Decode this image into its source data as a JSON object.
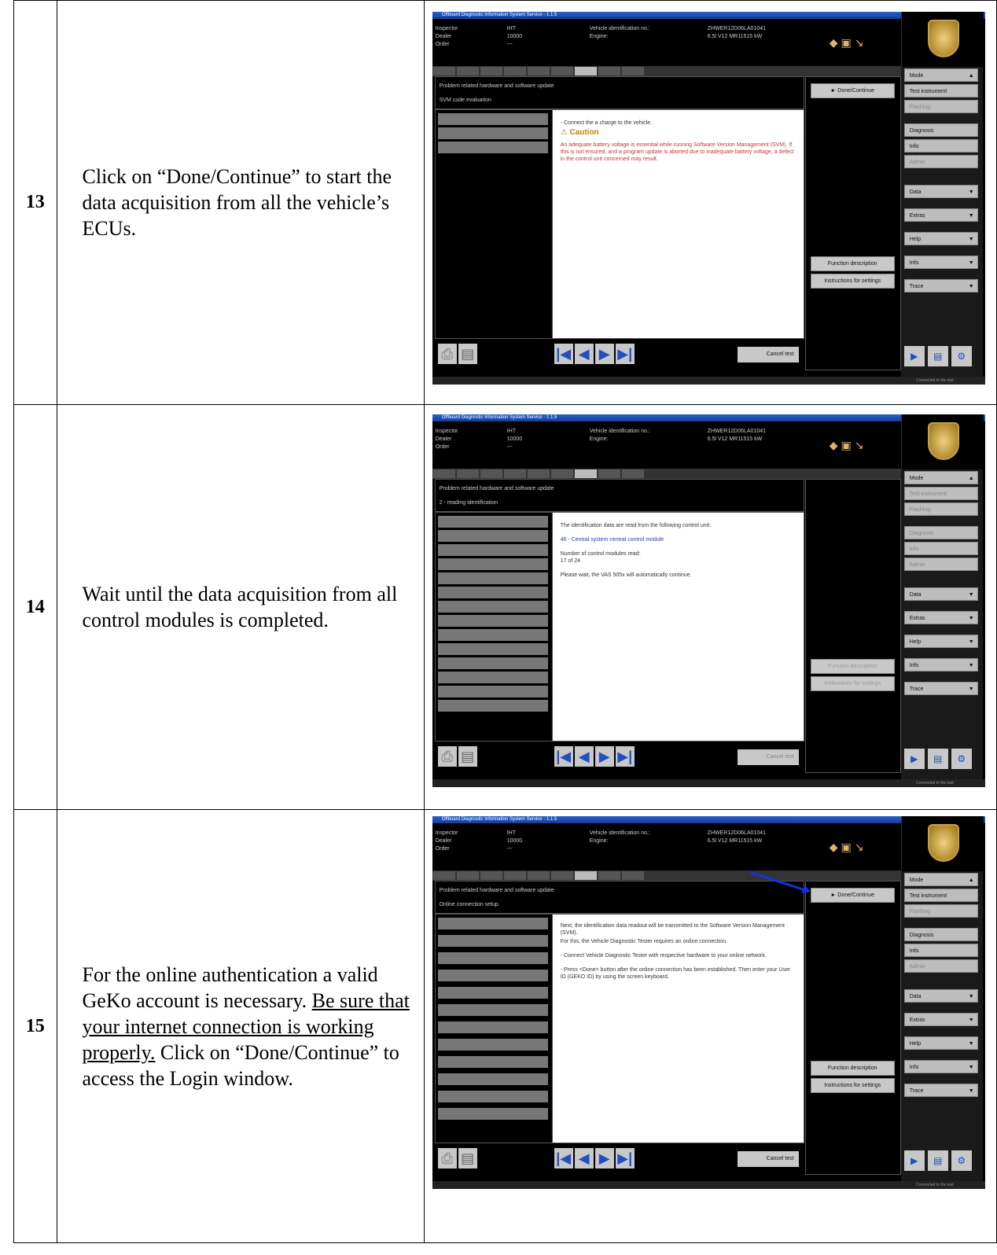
{
  "rows": [
    {
      "num": "13",
      "text": "Click on “Done/Continue” to start the data acquisition from all the vehicle’s ECUs.",
      "screen": {
        "title": "Offboard Diagnostic Information System Service - 1.1.5",
        "inspector_label": "Inspector",
        "inspector_value": "IHT",
        "dealer_label": "Dealer",
        "dealer_value": "10000",
        "order_label": "Order",
        "order_value": "---",
        "vin_label": "Vehicle identification no.:",
        "vin_value": "ZHWER12D06LA01041",
        "engine_label": "Engine:",
        "engine_value": "6.5l V12 MR11515 kW",
        "problem_title": "Problem related hardware and software update",
        "problem_sub": "SVM code evaluation",
        "content_line1": "- Connect the a charge to the vehicle.",
        "caution": "Caution",
        "content_red": "An adequate battery voltage is essential while running Software Version Management (SVM). If this is not ensured, and a program update is aborted due to inadequate battery voltage, a defect in the control unit concerned may result.",
        "done_btn": "► Done/Continue",
        "func_btn": "Function description",
        "instr_btn": "Instructions for settings",
        "cancel_btn": "Cancel test",
        "status": "Connected to the test"
      }
    },
    {
      "num": "14",
      "text": "Wait until the data acquisition from all control modules is completed.",
      "screen": {
        "title": "Offboard Diagnostic Information System Service - 1.1.5",
        "inspector_label": "Inspector",
        "inspector_value": "IHT",
        "dealer_label": "Dealer",
        "dealer_value": "10000",
        "order_label": "Order",
        "order_value": "---",
        "vin_label": "Vehicle identification no.:",
        "vin_value": "ZHWER12D06LA01041",
        "engine_label": "Engine:",
        "engine_value": "6.5l V12 MR11515 kW",
        "problem_title": "Problem related hardware and software update",
        "problem_sub": "2 - reading identification",
        "content_line1": "The identification data are read from the following control unit:",
        "content_blue": "46 - Central system central control module",
        "content_line2": "Number of control modules read:",
        "content_line3": "17 of 24",
        "content_line4": "Please wait, the VAS 505x will automatically continue.",
        "func_btn": "Function description",
        "instr_btn": "Instructions for settings",
        "cancel_btn": "Cancel test",
        "status": "Connected to the test"
      }
    },
    {
      "num": "15",
      "text_a": "For the online authentication a valid GeKo account is necessary.",
      "text_u": "Be sure that your internet connection is working properly.",
      "text_b": "Click on “Done/Continue” to access the Login window.",
      "screen": {
        "title": "Offboard Diagnostic Information System Service - 1.1.5",
        "inspector_label": "Inspector",
        "inspector_value": "IHT",
        "dealer_label": "Dealer",
        "dealer_value": "10000",
        "order_label": "Order",
        "order_value": "---",
        "vin_label": "Vehicle identification no.:",
        "vin_value": "ZHWER12D06LA01041",
        "engine_label": "Engine:",
        "engine_value": "6.5l V12 MR11515 kW",
        "problem_title": "Problem related hardware and software update",
        "problem_sub": "Online connection setup",
        "content_line1": "Next, the identification data readout will be transmitted to the Software Version Management (SVM).",
        "content_line2": "For this, the Vehicle Diagnostic Tester requires an online connection.",
        "content_line3": "- Connect Vehicle Diagnostic Tester with respective hardware to your online network.",
        "content_line4": "- Press <Done> button after the online connection has been established. Then enter your User ID (GEKO ID) by using the screen keyboard.",
        "done_btn": "► Done/Continue",
        "func_btn": "Function description",
        "instr_btn": "Instructions for settings",
        "cancel_btn": "Cancel test",
        "status": "Connected to the test"
      }
    }
  ],
  "sidebar": {
    "mode": "Mode",
    "test_instrument": "Test instrument",
    "flashing": "Flashing",
    "diagnosis": "Diagnosis",
    "info": "Info",
    "admin": "Admin",
    "data": "Data",
    "extras": "Extras",
    "help": "Help",
    "info2": "Info",
    "trace": "Trace"
  }
}
